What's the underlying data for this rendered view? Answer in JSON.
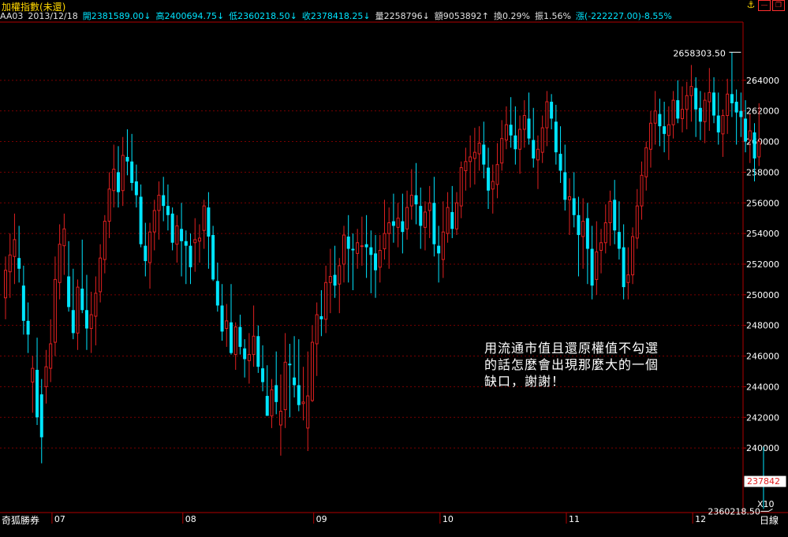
{
  "header": {
    "title": "加權指數(未還)",
    "name": "AA03",
    "date": "2013/12/18",
    "open": "開2381589.00↓",
    "high": "高2400694.75↓",
    "low": "低2360218.50↓",
    "close": "收2378418.25↓",
    "volume": "量2258796↓",
    "amount": "額9053892↑",
    "turnover": "換0.29%",
    "amplitude": "振1.56%",
    "change": "漲(-222227.00)-8.55%"
  },
  "footer": {
    "source": "奇狐勝券",
    "period": "日線",
    "scale": "X10"
  },
  "note": [
    "用流通市值且還原權值不勾選",
    "的話怎麼會出現那麼大的一個",
    "缺口，謝謝！"
  ],
  "colors": {
    "up": "#e02020",
    "down": "#00e5ff",
    "grid": "#7a0000",
    "axis": "#b00000",
    "label": "#ffffff"
  },
  "chart_data": {
    "type": "candlestick",
    "yaxis": {
      "ticks": [
        240000,
        242000,
        244000,
        246000,
        248000,
        250000,
        252000,
        254000,
        256000,
        258000,
        260000,
        262000,
        264000
      ],
      "tick_labels": [
        "240000",
        "242000",
        "244000",
        "246000",
        "248000",
        "250000",
        "252000",
        "254000",
        "256000",
        "258000",
        "260000",
        "262000",
        "264000"
      ],
      "range": [
        236300,
        267800
      ],
      "side": "right"
    },
    "xaxis": {
      "labels": [
        "07",
        "08",
        "09",
        "10",
        "11",
        "12"
      ],
      "label_index": [
        11,
        40,
        69,
        97,
        125,
        153
      ]
    },
    "annotations": {
      "max_label": "2658303.50",
      "max_value": 265830,
      "max_index": 163,
      "min_label": "2360218.50",
      "min_value": 236022,
      "min_index": 170,
      "last_label": "237842",
      "last_value": 237842
    },
    "candles": [
      {
        "o": 249800,
        "h": 252500,
        "l": 248400,
        "c": 251600
      },
      {
        "o": 251500,
        "h": 254000,
        "l": 249800,
        "c": 252600
      },
      {
        "o": 252500,
        "h": 255300,
        "l": 250700,
        "c": 253600
      },
      {
        "o": 252400,
        "h": 254500,
        "l": 250800,
        "c": 251700
      },
      {
        "o": 250600,
        "h": 251900,
        "l": 247400,
        "c": 248300
      },
      {
        "o": 248300,
        "h": 249500,
        "l": 246200,
        "c": 247400
      },
      {
        "o": 244300,
        "h": 246000,
        "l": 242300,
        "c": 245200
      },
      {
        "o": 245100,
        "h": 247200,
        "l": 241500,
        "c": 242000
      },
      {
        "o": 243500,
        "h": 244500,
        "l": 239000,
        "c": 240700
      },
      {
        "o": 244000,
        "h": 246400,
        "l": 242900,
        "c": 245300
      },
      {
        "o": 245200,
        "h": 248400,
        "l": 244300,
        "c": 246800
      },
      {
        "o": 246900,
        "h": 252500,
        "l": 246000,
        "c": 251000
      },
      {
        "o": 250800,
        "h": 254600,
        "l": 249700,
        "c": 253300
      },
      {
        "o": 253200,
        "h": 255300,
        "l": 251300,
        "c": 254300
      },
      {
        "o": 251200,
        "h": 253500,
        "l": 248900,
        "c": 249200
      },
      {
        "o": 249000,
        "h": 251700,
        "l": 247100,
        "c": 247500
      },
      {
        "o": 247500,
        "h": 251000,
        "l": 246400,
        "c": 250500
      },
      {
        "o": 250400,
        "h": 253600,
        "l": 248800,
        "c": 249000
      },
      {
        "o": 249000,
        "h": 251300,
        "l": 246400,
        "c": 247800
      },
      {
        "o": 247800,
        "h": 250200,
        "l": 246200,
        "c": 248700
      },
      {
        "o": 248600,
        "h": 251200,
        "l": 246700,
        "c": 250100
      },
      {
        "o": 250200,
        "h": 253300,
        "l": 249500,
        "c": 252400
      },
      {
        "o": 252300,
        "h": 255200,
        "l": 251400,
        "c": 254800
      },
      {
        "o": 254800,
        "h": 258000,
        "l": 253700,
        "c": 256900
      },
      {
        "o": 256800,
        "h": 259800,
        "l": 255700,
        "c": 258200
      },
      {
        "o": 258000,
        "h": 259700,
        "l": 255700,
        "c": 256700
      },
      {
        "o": 256800,
        "h": 260300,
        "l": 255800,
        "c": 259100
      },
      {
        "o": 259000,
        "h": 260800,
        "l": 257800,
        "c": 258700
      },
      {
        "o": 258700,
        "h": 260500,
        "l": 256800,
        "c": 257300
      },
      {
        "o": 257400,
        "h": 258500,
        "l": 255700,
        "c": 256500
      },
      {
        "o": 256400,
        "h": 257200,
        "l": 253100,
        "c": 253300
      },
      {
        "o": 253200,
        "h": 254700,
        "l": 251200,
        "c": 252200
      },
      {
        "o": 252100,
        "h": 254700,
        "l": 250400,
        "c": 254100
      },
      {
        "o": 254100,
        "h": 256200,
        "l": 252900,
        "c": 255500
      },
      {
        "o": 255500,
        "h": 257400,
        "l": 253600,
        "c": 256500
      },
      {
        "o": 256500,
        "h": 257700,
        "l": 254800,
        "c": 255800
      },
      {
        "o": 255800,
        "h": 257200,
        "l": 254200,
        "c": 255200
      },
      {
        "o": 255300,
        "h": 255700,
        "l": 252900,
        "c": 253400
      },
      {
        "o": 253300,
        "h": 255200,
        "l": 252100,
        "c": 254500
      },
      {
        "o": 254300,
        "h": 256000,
        "l": 251200,
        "c": 253500
      },
      {
        "o": 253500,
        "h": 254200,
        "l": 250700,
        "c": 253200
      },
      {
        "o": 253200,
        "h": 254000,
        "l": 250700,
        "c": 251800
      },
      {
        "o": 253400,
        "h": 255000,
        "l": 251500,
        "c": 253600
      },
      {
        "o": 253500,
        "h": 254600,
        "l": 252100,
        "c": 253700
      },
      {
        "o": 254200,
        "h": 256200,
        "l": 253000,
        "c": 255800
      },
      {
        "o": 255700,
        "h": 256700,
        "l": 251700,
        "c": 253800
      },
      {
        "o": 253900,
        "h": 254500,
        "l": 250900,
        "c": 251000
      },
      {
        "o": 250900,
        "h": 252100,
        "l": 248900,
        "c": 249300
      },
      {
        "o": 249300,
        "h": 250700,
        "l": 247000,
        "c": 247600
      },
      {
        "o": 247800,
        "h": 249400,
        "l": 246600,
        "c": 248300
      },
      {
        "o": 248200,
        "h": 250700,
        "l": 246100,
        "c": 246200
      },
      {
        "o": 246100,
        "h": 248200,
        "l": 245100,
        "c": 247900
      },
      {
        "o": 247900,
        "h": 248700,
        "l": 246100,
        "c": 246600
      },
      {
        "o": 246500,
        "h": 247100,
        "l": 244600,
        "c": 245800
      },
      {
        "o": 245700,
        "h": 247500,
        "l": 244200,
        "c": 246100
      },
      {
        "o": 246100,
        "h": 249300,
        "l": 245300,
        "c": 247300
      },
      {
        "o": 247300,
        "h": 248000,
        "l": 244900,
        "c": 245300
      },
      {
        "o": 245200,
        "h": 246700,
        "l": 243700,
        "c": 244300
      },
      {
        "o": 243400,
        "h": 245400,
        "l": 242100,
        "c": 242100
      },
      {
        "o": 242100,
        "h": 244500,
        "l": 241300,
        "c": 243800
      },
      {
        "o": 244100,
        "h": 246300,
        "l": 242200,
        "c": 243000
      },
      {
        "o": 241500,
        "h": 244800,
        "l": 239500,
        "c": 242400
      },
      {
        "o": 242500,
        "h": 247500,
        "l": 241300,
        "c": 245600
      },
      {
        "o": 245500,
        "h": 246800,
        "l": 242000,
        "c": 245400
      },
      {
        "o": 244600,
        "h": 247300,
        "l": 243300,
        "c": 244100
      },
      {
        "o": 244100,
        "h": 247100,
        "l": 242400,
        "c": 242800
      },
      {
        "o": 242900,
        "h": 245300,
        "l": 241800,
        "c": 243000
      },
      {
        "o": 241300,
        "h": 246300,
        "l": 239800,
        "c": 243400
      },
      {
        "o": 243100,
        "h": 248000,
        "l": 243000,
        "c": 246900
      },
      {
        "o": 246800,
        "h": 249500,
        "l": 244700,
        "c": 248700
      },
      {
        "o": 248600,
        "h": 250300,
        "l": 247300,
        "c": 248400
      },
      {
        "o": 248400,
        "h": 251900,
        "l": 247500,
        "c": 250800
      },
      {
        "o": 250800,
        "h": 253000,
        "l": 248800,
        "c": 251200
      },
      {
        "o": 251300,
        "h": 253200,
        "l": 249800,
        "c": 250600
      },
      {
        "o": 250700,
        "h": 252400,
        "l": 248800,
        "c": 251900
      },
      {
        "o": 252000,
        "h": 254500,
        "l": 250800,
        "c": 253900
      },
      {
        "o": 253800,
        "h": 255200,
        "l": 250800,
        "c": 253000
      },
      {
        "o": 253000,
        "h": 254000,
        "l": 250300,
        "c": 252900
      },
      {
        "o": 252700,
        "h": 254300,
        "l": 251700,
        "c": 253400
      },
      {
        "o": 253200,
        "h": 255100,
        "l": 251900,
        "c": 253200
      },
      {
        "o": 253300,
        "h": 255200,
        "l": 251100,
        "c": 253100
      },
      {
        "o": 253100,
        "h": 254200,
        "l": 250100,
        "c": 252600
      },
      {
        "o": 252700,
        "h": 253900,
        "l": 249800,
        "c": 251600
      },
      {
        "o": 251800,
        "h": 253900,
        "l": 250800,
        "c": 252900
      },
      {
        "o": 253000,
        "h": 256200,
        "l": 252300,
        "c": 254000
      },
      {
        "o": 254000,
        "h": 255700,
        "l": 251700,
        "c": 254700
      },
      {
        "o": 254800,
        "h": 256600,
        "l": 253400,
        "c": 254500
      },
      {
        "o": 254400,
        "h": 256000,
        "l": 253100,
        "c": 255000
      },
      {
        "o": 254800,
        "h": 256600,
        "l": 252700,
        "c": 254100
      },
      {
        "o": 254300,
        "h": 256800,
        "l": 253600,
        "c": 255700
      },
      {
        "o": 255800,
        "h": 258200,
        "l": 254900,
        "c": 256500
      },
      {
        "o": 256500,
        "h": 258600,
        "l": 254600,
        "c": 255900
      },
      {
        "o": 255800,
        "h": 257000,
        "l": 253000,
        "c": 254500
      },
      {
        "o": 254400,
        "h": 256100,
        "l": 252900,
        "c": 255400
      },
      {
        "o": 255500,
        "h": 257100,
        "l": 253700,
        "c": 256000
      },
      {
        "o": 256000,
        "h": 257700,
        "l": 252500,
        "c": 253300
      },
      {
        "o": 253200,
        "h": 254500,
        "l": 250800,
        "c": 252700
      },
      {
        "o": 252300,
        "h": 256100,
        "l": 251100,
        "c": 254100
      },
      {
        "o": 254000,
        "h": 256700,
        "l": 253400,
        "c": 255700
      },
      {
        "o": 255400,
        "h": 257100,
        "l": 253700,
        "c": 254300
      },
      {
        "o": 254300,
        "h": 256700,
        "l": 253900,
        "c": 256000
      },
      {
        "o": 255800,
        "h": 258700,
        "l": 255000,
        "c": 258300
      },
      {
        "o": 258100,
        "h": 259600,
        "l": 256800,
        "c": 258700
      },
      {
        "o": 258700,
        "h": 260400,
        "l": 257000,
        "c": 259000
      },
      {
        "o": 258900,
        "h": 260900,
        "l": 257200,
        "c": 259300
      },
      {
        "o": 259200,
        "h": 261000,
        "l": 258100,
        "c": 259900
      },
      {
        "o": 259800,
        "h": 261300,
        "l": 257600,
        "c": 258500
      },
      {
        "o": 258300,
        "h": 259600,
        "l": 255600,
        "c": 256800
      },
      {
        "o": 256900,
        "h": 258500,
        "l": 255300,
        "c": 257400
      },
      {
        "o": 257200,
        "h": 259900,
        "l": 256300,
        "c": 258500
      },
      {
        "o": 258600,
        "h": 261400,
        "l": 258100,
        "c": 260200
      },
      {
        "o": 260100,
        "h": 262300,
        "l": 259500,
        "c": 261100
      },
      {
        "o": 261100,
        "h": 262900,
        "l": 259600,
        "c": 260400
      },
      {
        "o": 260400,
        "h": 262300,
        "l": 258500,
        "c": 259500
      },
      {
        "o": 259500,
        "h": 261700,
        "l": 257900,
        "c": 260800
      },
      {
        "o": 260800,
        "h": 262700,
        "l": 259600,
        "c": 261700
      },
      {
        "o": 261500,
        "h": 263200,
        "l": 259800,
        "c": 260200
      },
      {
        "o": 260100,
        "h": 262200,
        "l": 258300,
        "c": 258900
      },
      {
        "o": 258800,
        "h": 260400,
        "l": 256900,
        "c": 259500
      },
      {
        "o": 259300,
        "h": 261700,
        "l": 258600,
        "c": 260900
      },
      {
        "o": 260900,
        "h": 263300,
        "l": 259700,
        "c": 262600
      },
      {
        "o": 262600,
        "h": 263100,
        "l": 260800,
        "c": 261500
      },
      {
        "o": 261300,
        "h": 262400,
        "l": 258500,
        "c": 259300
      },
      {
        "o": 259200,
        "h": 261000,
        "l": 257300,
        "c": 258100
      },
      {
        "o": 258000,
        "h": 259800,
        "l": 255500,
        "c": 256200
      },
      {
        "o": 256200,
        "h": 257600,
        "l": 253900,
        "c": 256400
      },
      {
        "o": 256300,
        "h": 258000,
        "l": 254400,
        "c": 255200
      },
      {
        "o": 255200,
        "h": 256400,
        "l": 251200,
        "c": 253900
      },
      {
        "o": 253800,
        "h": 256300,
        "l": 251700,
        "c": 254800
      },
      {
        "o": 255000,
        "h": 256000,
        "l": 250700,
        "c": 253000
      },
      {
        "o": 253000,
        "h": 254500,
        "l": 249700,
        "c": 250600
      },
      {
        "o": 251000,
        "h": 254800,
        "l": 250000,
        "c": 252800
      },
      {
        "o": 252900,
        "h": 254300,
        "l": 251400,
        "c": 253400
      },
      {
        "o": 253400,
        "h": 255900,
        "l": 252700,
        "c": 254700
      },
      {
        "o": 254700,
        "h": 256800,
        "l": 253200,
        "c": 256100
      },
      {
        "o": 256200,
        "h": 257500,
        "l": 253300,
        "c": 254200
      },
      {
        "o": 254100,
        "h": 256100,
        "l": 252300,
        "c": 253000
      },
      {
        "o": 253100,
        "h": 254600,
        "l": 249700,
        "c": 250500
      },
      {
        "o": 250800,
        "h": 253100,
        "l": 249700,
        "c": 251300
      },
      {
        "o": 251300,
        "h": 254400,
        "l": 250700,
        "c": 253800
      },
      {
        "o": 253700,
        "h": 256900,
        "l": 253000,
        "c": 255800
      },
      {
        "o": 255800,
        "h": 258700,
        "l": 254900,
        "c": 257800
      },
      {
        "o": 257700,
        "h": 260000,
        "l": 256800,
        "c": 259600
      },
      {
        "o": 259500,
        "h": 262000,
        "l": 258300,
        "c": 261200
      },
      {
        "o": 261200,
        "h": 263300,
        "l": 259800,
        "c": 262000
      },
      {
        "o": 261800,
        "h": 262800,
        "l": 259700,
        "c": 261000
      },
      {
        "o": 261000,
        "h": 262600,
        "l": 259300,
        "c": 260500
      },
      {
        "o": 260400,
        "h": 262300,
        "l": 258800,
        "c": 261100
      },
      {
        "o": 261100,
        "h": 263300,
        "l": 260200,
        "c": 262700
      },
      {
        "o": 262700,
        "h": 264000,
        "l": 261200,
        "c": 261500
      },
      {
        "o": 261500,
        "h": 263600,
        "l": 260600,
        "c": 262100
      },
      {
        "o": 262100,
        "h": 263900,
        "l": 260800,
        "c": 263000
      },
      {
        "o": 263000,
        "h": 265000,
        "l": 261300,
        "c": 263600
      },
      {
        "o": 263500,
        "h": 264200,
        "l": 260300,
        "c": 262100
      },
      {
        "o": 262200,
        "h": 263300,
        "l": 260100,
        "c": 261300
      },
      {
        "o": 261300,
        "h": 263200,
        "l": 259900,
        "c": 262700
      },
      {
        "o": 262600,
        "h": 264800,
        "l": 260700,
        "c": 263200
      },
      {
        "o": 263200,
        "h": 264200,
        "l": 261200,
        "c": 261700
      },
      {
        "o": 261700,
        "h": 263200,
        "l": 259800,
        "c": 260600
      },
      {
        "o": 260500,
        "h": 262100,
        "l": 259000,
        "c": 261700
      },
      {
        "o": 261700,
        "h": 264100,
        "l": 260500,
        "c": 263100
      },
      {
        "o": 263100,
        "h": 265830,
        "l": 261600,
        "c": 262500
      },
      {
        "o": 262600,
        "h": 263400,
        "l": 259800,
        "c": 261900
      },
      {
        "o": 262000,
        "h": 263200,
        "l": 260300,
        "c": 261600
      },
      {
        "o": 261500,
        "h": 262700,
        "l": 259300,
        "c": 260000
      },
      {
        "o": 260100,
        "h": 261800,
        "l": 258600,
        "c": 260700
      },
      {
        "o": 260600,
        "h": 261200,
        "l": 257400,
        "c": 258900
      },
      {
        "o": 259000,
        "h": 262500,
        "l": 258400,
        "c": 260000
      },
      {
        "o": 238159,
        "h": 240069,
        "l": 236022,
        "c": 237842
      }
    ]
  }
}
